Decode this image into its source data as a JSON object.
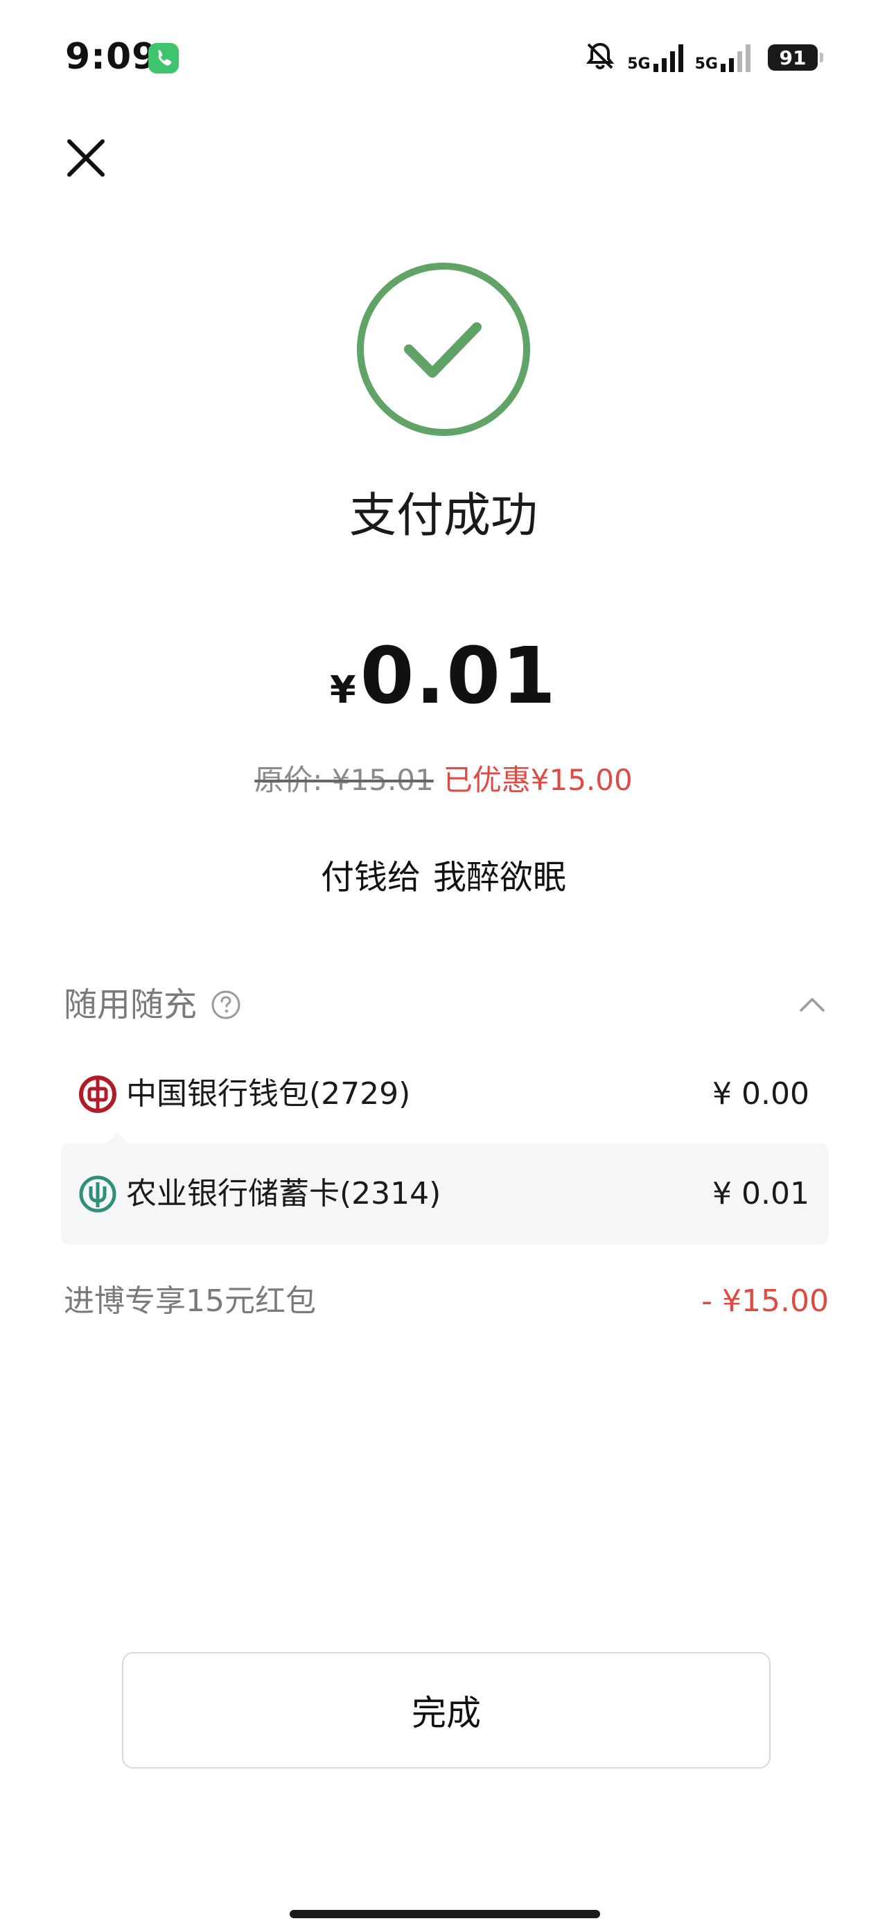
{
  "status_bar": {
    "time": "9:09",
    "net1": "5G",
    "net2": "5G",
    "battery": "91"
  },
  "icons": {
    "close": "close-icon",
    "success": "checkmark-circle-icon",
    "help": "question-circle-icon",
    "collapse": "chevron-up-icon",
    "boc": "bank-of-china-logo",
    "abc": "agricultural-bank-logo"
  },
  "colors": {
    "success_green": "#5fa366",
    "discount_red": "#e04a43",
    "boc_red": "#b01d28",
    "abc_green": "#2f8f7a"
  },
  "payment": {
    "title": "支付成功",
    "currency": "¥",
    "amount": "0.01",
    "original_price": "原价: ¥15.01",
    "discount_text": "已优惠¥15.00",
    "pay_to_prefix": "付钱给",
    "payee": "我醉欲眠"
  },
  "breakdown": {
    "title": "随用随充",
    "items": [
      {
        "name": "中国银行钱包(2729)",
        "amount": "¥ 0.00"
      },
      {
        "name": "农业银行储蓄卡(2314)",
        "amount": "¥ 0.01"
      }
    ],
    "coupon_label": "进博专享15元红包",
    "coupon_amount": "- ¥15.00"
  },
  "actions": {
    "done": "完成"
  }
}
